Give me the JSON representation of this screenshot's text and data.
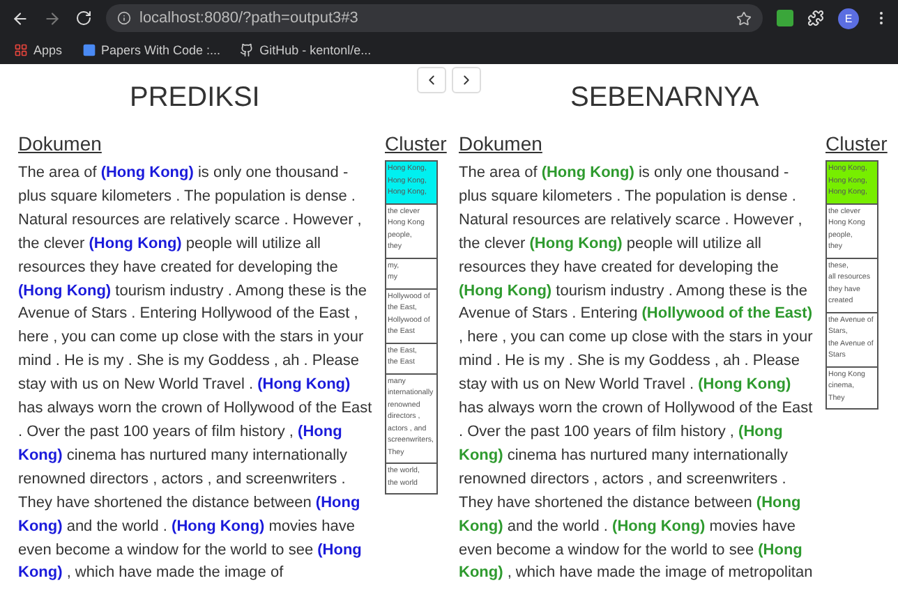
{
  "browser": {
    "url": "localhost:8080/?path=output3#3",
    "avatar": "E",
    "bookmarks": [
      {
        "kind": "apps",
        "label": "Apps"
      },
      {
        "kind": "page",
        "label": "Papers With Code :..."
      },
      {
        "kind": "github",
        "label": "GitHub - kentonl/e..."
      }
    ]
  },
  "panels": [
    {
      "title": "PREDIKSI",
      "doc_header": "Dokumen",
      "cluster_header": "Cluster",
      "color": "#1a1adb",
      "segments": [
        {
          "text": "The area of ",
          "highlight": false
        },
        {
          "text": "(Hong Kong)",
          "highlight": true
        },
        {
          "text": " is only one thousand - plus square kilometers . The population is dense . Natural resources are relatively scarce . However , the clever ",
          "highlight": false
        },
        {
          "text": "(Hong Kong)",
          "highlight": true
        },
        {
          "text": " people will utilize all resources they have created for developing the ",
          "highlight": false
        },
        {
          "text": "(Hong Kong)",
          "highlight": true
        },
        {
          "text": " tourism industry . Among these is the Avenue of Stars . Entering Hollywood of the East , here , you can come up close with the stars in your mind . He is my . She is my Goddess , ah . Please stay with us on New World Travel . ",
          "highlight": false
        },
        {
          "text": "(Hong Kong)",
          "highlight": true
        },
        {
          "text": " has always worn the crown of Hollywood of the East . Over the past 100 years of film history , ",
          "highlight": false
        },
        {
          "text": "(Hong Kong)",
          "highlight": true
        },
        {
          "text": " cinema has nurtured many internationally renowned directors , actors , and screenwriters . They have shortened the distance between ",
          "highlight": false
        },
        {
          "text": "(Hong Kong)",
          "highlight": true
        },
        {
          "text": " and the world . ",
          "highlight": false
        },
        {
          "text": "(Hong Kong)",
          "highlight": true
        },
        {
          "text": " movies have even become a window for the world to see ",
          "highlight": false
        },
        {
          "text": "(Hong Kong)",
          "highlight": true
        },
        {
          "text": " , which have made the image of",
          "highlight": false
        }
      ],
      "clusters": [
        {
          "lines": [
            "Hong Kong,",
            "Hong Kong,",
            "Hong Kong,"
          ],
          "highlighted": true,
          "color": "#00f0f0"
        },
        {
          "lines": [
            "the clever Hong Kong people,",
            "they"
          ],
          "highlighted": false
        },
        {
          "lines": [
            "my,",
            "my"
          ],
          "highlighted": false
        },
        {
          "lines": [
            "Hollywood of the East,",
            "Hollywood of the East"
          ],
          "highlighted": false
        },
        {
          "lines": [
            "the East,",
            "the East"
          ],
          "highlighted": false
        },
        {
          "lines": [
            "many internationally renowned directors , actors , and screenwriters,",
            "They"
          ],
          "highlighted": false
        },
        {
          "lines": [
            "the world,",
            "the world"
          ],
          "highlighted": false
        }
      ]
    },
    {
      "title": "SEBENARNYA",
      "doc_header": "Dokumen",
      "cluster_header": "Cluster",
      "color": "#2e9a2e",
      "segments": [
        {
          "text": "The area of ",
          "highlight": false
        },
        {
          "text": "(Hong Kong)",
          "highlight": true
        },
        {
          "text": " is only one thousand - plus square kilometers . The population is dense . Natural resources are relatively scarce . However , the clever ",
          "highlight": false
        },
        {
          "text": "(Hong Kong)",
          "highlight": true
        },
        {
          "text": " people will utilize all resources they have created for developing the ",
          "highlight": false
        },
        {
          "text": "(Hong Kong)",
          "highlight": true
        },
        {
          "text": " tourism industry . Among these is the Avenue of Stars . Entering ",
          "highlight": false
        },
        {
          "text": "(Hollywood of the East)",
          "highlight": true
        },
        {
          "text": " , here , you can come up close with the stars in your mind . He is my . She is my Goddess , ah . Please stay with us on New World Travel . ",
          "highlight": false
        },
        {
          "text": "(Hong Kong)",
          "highlight": true
        },
        {
          "text": " has always worn the crown of Hollywood of the East . Over the past 100 years of film history , ",
          "highlight": false
        },
        {
          "text": "(Hong Kong)",
          "highlight": true
        },
        {
          "text": " cinema has nurtured many internationally renowned directors , actors , and screenwriters . They have shortened the distance between ",
          "highlight": false
        },
        {
          "text": "(Hong Kong)",
          "highlight": true
        },
        {
          "text": " and the world . ",
          "highlight": false
        },
        {
          "text": "(Hong Kong)",
          "highlight": true
        },
        {
          "text": " movies have even become a window for the world to see ",
          "highlight": false
        },
        {
          "text": "(Hong Kong)",
          "highlight": true
        },
        {
          "text": " , which have made the image of metropolitan",
          "highlight": false
        }
      ],
      "clusters": [
        {
          "lines": [
            "Hong Kong,",
            "Hong Kong,",
            "Hong Kong,"
          ],
          "highlighted": true,
          "color": "#77ee00"
        },
        {
          "lines": [
            "the clever Hong Kong people,",
            "they"
          ],
          "highlighted": false
        },
        {
          "lines": [
            "these,",
            "all resources they have created"
          ],
          "highlighted": false
        },
        {
          "lines": [
            "the Avenue of Stars,",
            "the Avenue of Stars"
          ],
          "highlighted": false
        },
        {
          "lines": [
            "Hong Kong cinema,",
            "They"
          ],
          "highlighted": false
        }
      ]
    }
  ]
}
